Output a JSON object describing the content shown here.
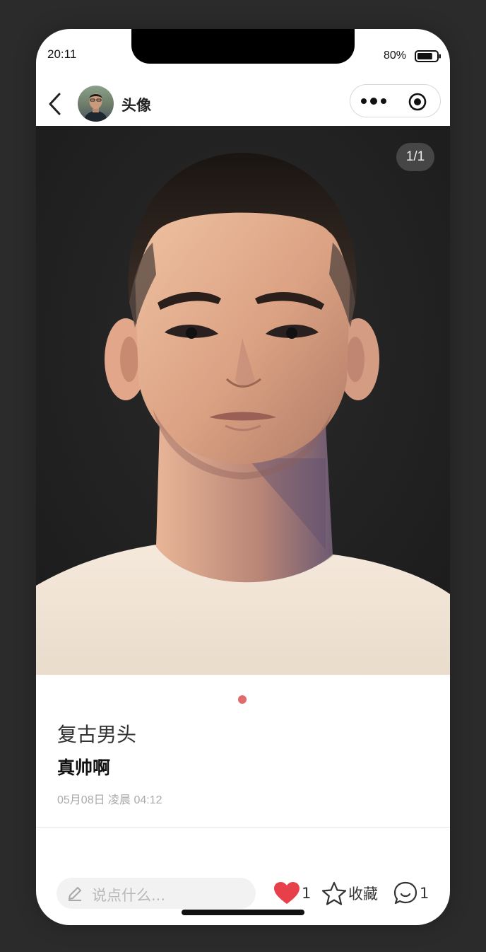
{
  "status_bar": {
    "time": "20:11",
    "battery_percent": "80%",
    "battery_level": 0.8
  },
  "navbar": {
    "title": "头像",
    "back_icon": "chevron-left-icon",
    "avatar_icon": "avatar-icon",
    "menu_icon": "more-dots-icon",
    "close_icon": "target-circle-icon"
  },
  "gallery": {
    "counter": "1/1",
    "active_dot_color": "#e06b6b"
  },
  "post": {
    "title": "复古男头",
    "body": "真帅啊",
    "time": "05月08日 凌晨 04:12"
  },
  "bottom_bar": {
    "comment_placeholder": "说点什么...",
    "like_count": "1",
    "favorite_label": "收藏",
    "comment_count": "1",
    "like_color": "#e8404a"
  }
}
